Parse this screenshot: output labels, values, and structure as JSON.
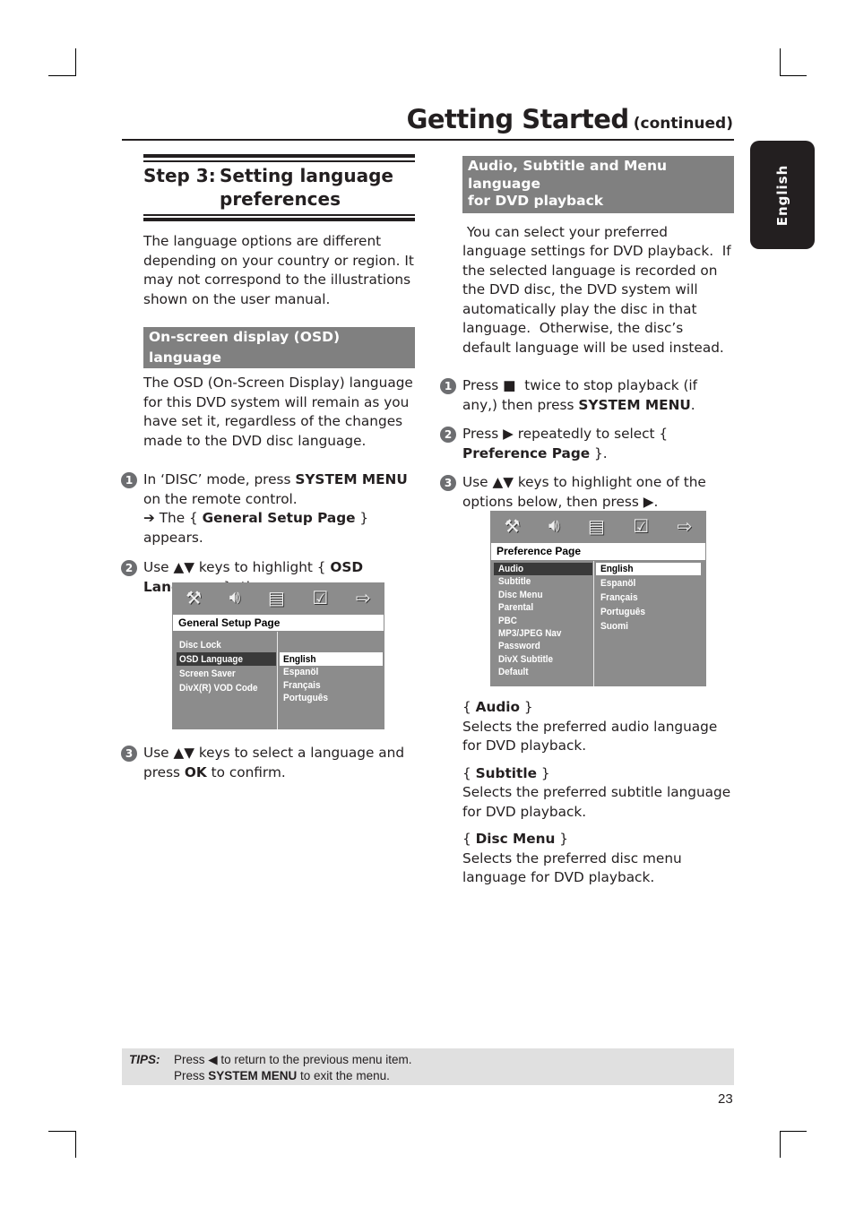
{
  "header": {
    "title": "Getting Started",
    "subtitle": "(continued)",
    "language_tab": "English"
  },
  "left": {
    "step_heading": {
      "number": "Step 3:",
      "title_line1": "Setting language",
      "title_line2": "preferences"
    },
    "intro": "The language options are different depending on your country or region. It may not correspond to the illustrations shown on the user manual.",
    "section_title": "On-screen display (OSD) language",
    "section_body": "The OSD (On-Screen Display) language for this DVD system will remain as you have set it, regardless of the changes made to the DVD disc language.",
    "steps": [
      {
        "num": "1",
        "pre": "In ‘DISC’ mode, press ",
        "bold": "SYSTEM MENU",
        "post": " on the remote control.",
        "result_arrow": "➔",
        "result_pre": " The { ",
        "result_bold": "General Setup Page",
        "result_post": " } appears."
      },
      {
        "num": "2",
        "pre": "Use ▲▼ keys to highlight  { ",
        "bold": "OSD Language",
        "post": " }, then press ▶."
      },
      {
        "num": "3",
        "pre": "Use ▲▼ keys to select a language and press ",
        "bold": "OK",
        "post": " to confirm."
      }
    ],
    "osd_menu": {
      "icons": [
        "tools-icon",
        "speaker-icon",
        "film-icon",
        "checklist-icon",
        "exit-icon"
      ],
      "page_title": "General Setup Page",
      "items": [
        "Disc Lock",
        "OSD Language",
        "Screen Saver",
        "DivX(R) VOD Code"
      ],
      "selected_item": "OSD Language",
      "options": [
        "English",
        "Espanöl",
        "Français",
        "Português"
      ],
      "selected_option": "English"
    }
  },
  "right": {
    "section_title_line1": "Audio, Subtitle and Menu language",
    "section_title_line2": "for DVD playback",
    "intro": " You can select your preferred language settings for DVD playback.  If the selected language is recorded on the DVD disc, the DVD system will automatically play the disc in that language.  Otherwise, the disc’s default language will be used instead.",
    "steps": [
      {
        "num": "1",
        "pre": "Press ■  twice to stop playback (if any,) then press ",
        "bold": "SYSTEM MENU",
        "post": "."
      },
      {
        "num": "2",
        "pre": "Press ▶ repeatedly to select { ",
        "bold": "Preference Page",
        "post": " }."
      },
      {
        "num": "3",
        "pre": "Use ▲▼ keys to highlight one of the options below, then press ▶.",
        "bold": "",
        "post": ""
      }
    ],
    "osd_menu": {
      "icons": [
        "tools-icon",
        "speaker-icon",
        "film-icon",
        "checklist-icon",
        "exit-icon"
      ],
      "page_title": "Preference Page",
      "items": [
        "Audio",
        "Subtitle",
        "Disc Menu",
        "Parental",
        "PBC",
        "MP3/JPEG Nav",
        "Password",
        "DivX Subtitle",
        "Default"
      ],
      "selected_item": "Audio",
      "options": [
        "English",
        "Espanöl",
        "Français",
        "Português",
        "Suomi"
      ],
      "selected_option": "English"
    },
    "definitions": [
      {
        "term": "Audio",
        "desc": "Selects the preferred audio language for DVD playback."
      },
      {
        "term": "Subtitle",
        "desc": "Selects the preferred subtitle language for DVD playback."
      },
      {
        "term": "Disc Menu",
        "desc": "Selects the preferred disc menu language for DVD playback."
      }
    ]
  },
  "tips": {
    "label": "TIPS:",
    "line1": "Press ◀ to return to the previous menu item.",
    "line2_pre": "Press ",
    "line2_bold": "SYSTEM MENU",
    "line2_post": " to exit the menu."
  },
  "page_number": "23"
}
